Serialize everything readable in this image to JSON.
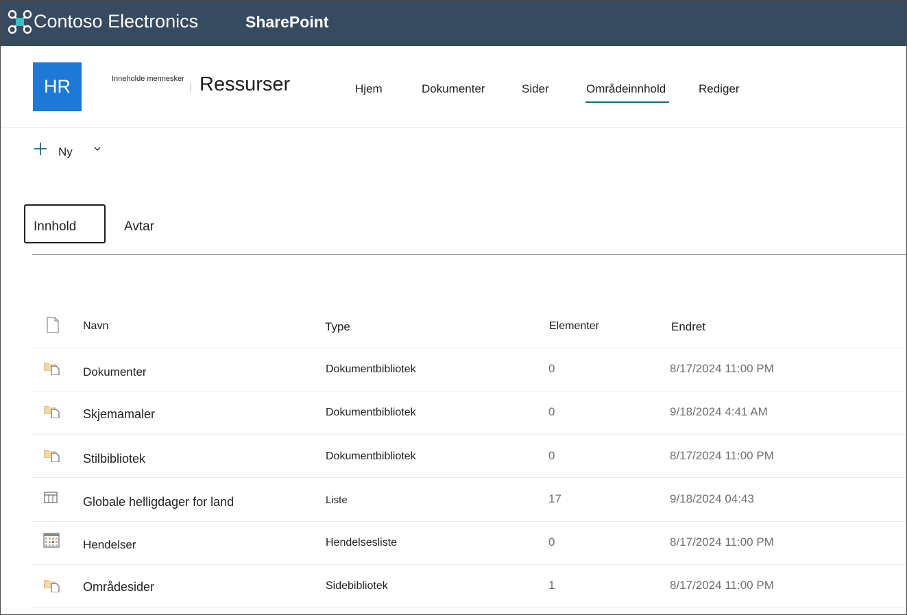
{
  "suite": {
    "company": "Contoso Electronics",
    "product": "SharePoint"
  },
  "site": {
    "logo_text": "HR",
    "subtitle": "Inneholde mennesker",
    "title": "Ressurser",
    "nav": [
      "Hjem",
      "Dokumenter",
      "Sider",
      "Områdeinnhold",
      "Rediger"
    ],
    "active_nav": "Områdeinnhold"
  },
  "command_bar": {
    "new_label": "Ny"
  },
  "tabs": {
    "items": [
      "Innhold",
      "Avtar"
    ],
    "selected": "Innhold"
  },
  "table": {
    "columns": {
      "name": "Navn",
      "type": "Type",
      "items": "Elementer",
      "modified": "Endret"
    },
    "rows": [
      {
        "icon": "document-library-icon",
        "name": "Dokumenter",
        "type": "Dokumentbibliotek",
        "count": "0",
        "date": "8/17/2024 11:00 PM"
      },
      {
        "icon": "document-library-icon",
        "name": "Skjemamaler",
        "type": "Dokumentbibliotek",
        "count": "0",
        "date": "9/18/2024 4:41 AM"
      },
      {
        "icon": "document-library-icon",
        "name": "Stilbibliotek",
        "type": "Dokumentbibliotek",
        "count": "0",
        "date": "8/17/2024 11:00 PM"
      },
      {
        "icon": "list-icon",
        "name": "Globale helligdager for land",
        "type": "Liste",
        "count": "17",
        "date": "9/18/2024 04:43"
      },
      {
        "icon": "calendar-icon",
        "name": "Hendelser",
        "type": "Hendelsesliste",
        "count": "0",
        "date": "8/17/2024 11:00 PM"
      },
      {
        "icon": "document-library-icon",
        "name": "Områdesider",
        "type": "Sidebibliotek",
        "count": "1",
        "date": "8/17/2024 11:00 PM"
      }
    ]
  },
  "colors": {
    "suite_bar": "#364a60",
    "site_logo": "#1e78d6",
    "accent": "#1c6b6e",
    "library_icon": "#e8b060"
  }
}
